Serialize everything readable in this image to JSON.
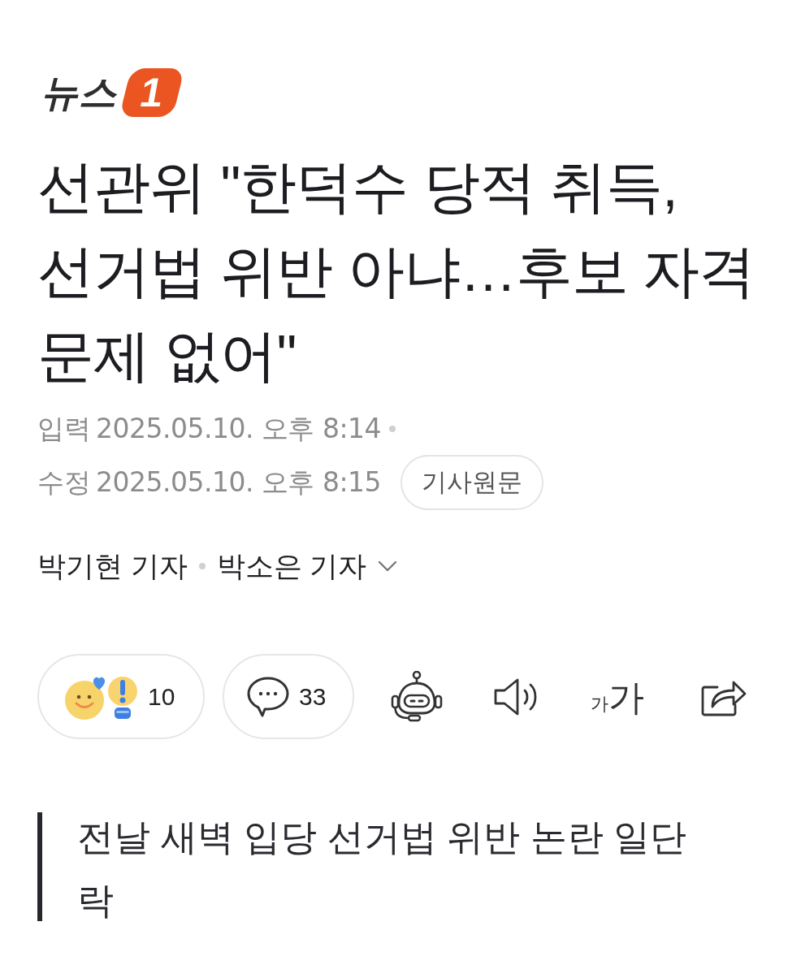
{
  "logo": {
    "wordmark": "뉴스",
    "badge": "1"
  },
  "headline": "선관위 \"한덕수 당적 취득, 선거법 위반 아냐…후보 자격 문제 없어\"",
  "timestamps": [
    {
      "label": "입력",
      "value": "2025.05.10. 오후 8:14"
    },
    {
      "label": "수정",
      "value": "2025.05.10. 오후 8:15"
    }
  ],
  "original_article_button": "기사원문",
  "reporters": [
    "박기현 기자",
    "박소은 기자"
  ],
  "actions": [
    {
      "kind": "reaction",
      "count": "10"
    },
    {
      "kind": "comment",
      "count": "33"
    },
    {
      "kind": "summary_bot"
    },
    {
      "kind": "read_aloud"
    },
    {
      "kind": "font_size",
      "small": "가",
      "large": "가"
    },
    {
      "kind": "share"
    }
  ],
  "subheadline": "전날 새벽 입당 선거법 위반 논란 일단락"
}
